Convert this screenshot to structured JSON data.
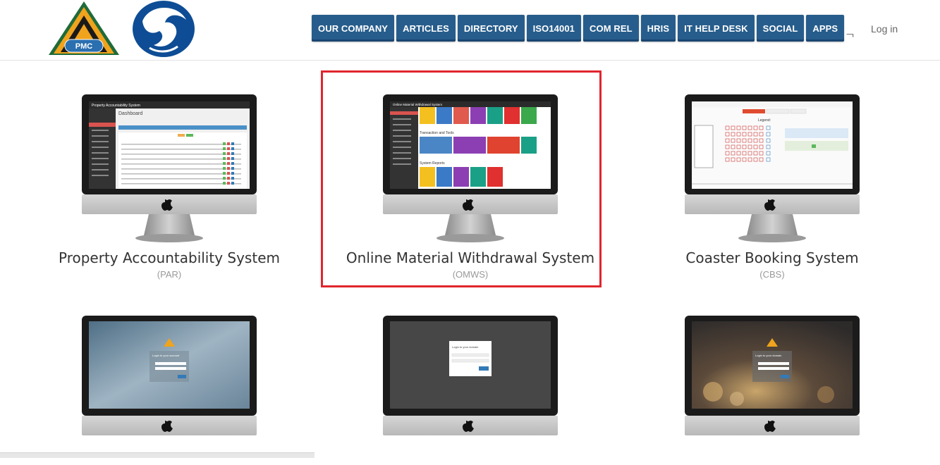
{
  "header": {
    "logo_text": "PMC",
    "nav": [
      "OUR COMPANY",
      "ARTICLES",
      "DIRECTORY",
      "ISO14001",
      "COM REL",
      "HRIS",
      "IT HELP DESK",
      "SOCIAL",
      "APPS"
    ],
    "search_glyph": "ᆨ",
    "login": "Log in",
    "nav_color": "#275d8c"
  },
  "apps": [
    {
      "title": "Property Accountability System",
      "abbr": "(PAR)",
      "screen": "dashboard-table",
      "app_header": "Property Accountability System",
      "page_heading": "Dashboard"
    },
    {
      "title": "Online Material Withdrawal System",
      "abbr": "(OMWS)",
      "screen": "tiles",
      "app_header": "Online Material Withdrawal System",
      "section1": "Transaction and Tools",
      "section2": "System Reports"
    },
    {
      "title": "Coaster Booking System",
      "abbr": "(CBS)",
      "screen": "seats",
      "app_header": "",
      "legend": "Legend:"
    },
    {
      "title": "",
      "abbr": "",
      "screen": "login-blue",
      "login_label": "Login to your account"
    },
    {
      "title": "",
      "abbr": "",
      "screen": "login-dark",
      "login_label": "Login to your domain"
    },
    {
      "title": "",
      "abbr": "",
      "screen": "login-flowers",
      "login_label": "Login to your domain"
    }
  ],
  "selected_app": "Online Material Withdrawal System",
  "highlight_color": "#e0262e"
}
